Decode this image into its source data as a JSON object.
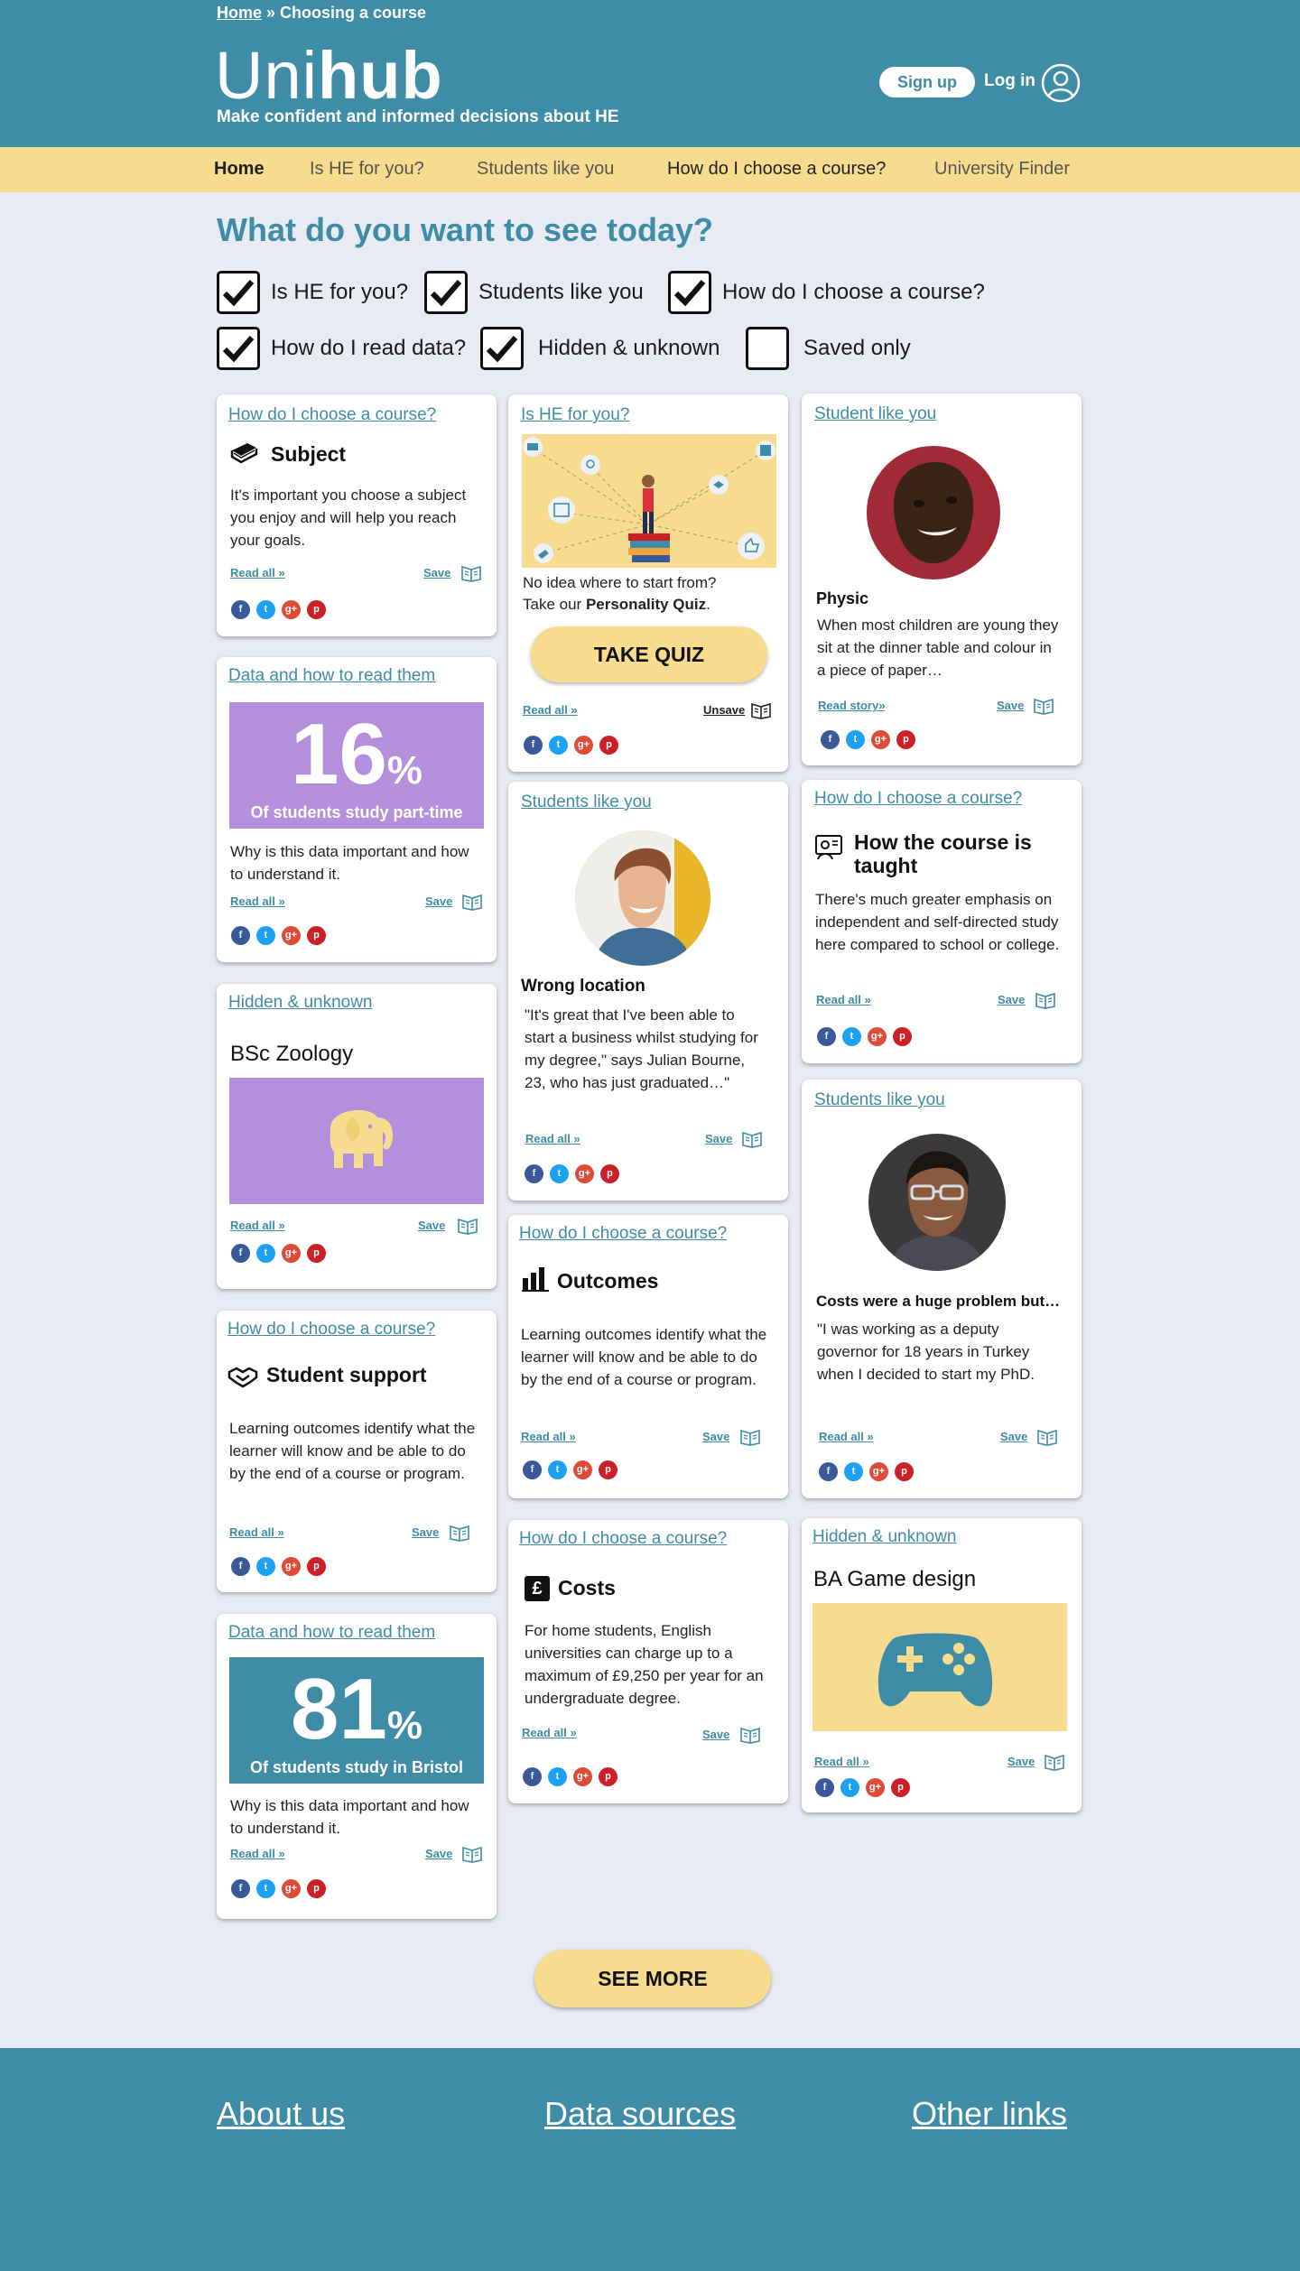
{
  "header": {
    "breadcrumb_home": "Home",
    "breadcrumb_sep": " » ",
    "breadcrumb_current": "Choosing a course",
    "logo_part1": "Uni",
    "logo_part2": "hub",
    "tagline": "Make confident and informed decisions about HE",
    "signup": "Sign up",
    "login": "Log in"
  },
  "nav": {
    "items": [
      "Home",
      "Is HE for you?",
      "Students like you",
      "How do I choose a course?",
      "University Finder"
    ]
  },
  "heading": "What do you want to see today?",
  "filters": [
    {
      "label": "Is HE for you?",
      "checked": true
    },
    {
      "label": "Students like you",
      "checked": true
    },
    {
      "label": "How do I choose a course?",
      "checked": true
    },
    {
      "label": "How do I read data?",
      "checked": true
    },
    {
      "label": "Hidden & unknown",
      "checked": true
    },
    {
      "label": "Saved only",
      "checked": false
    }
  ],
  "common": {
    "read_all": "Read all »",
    "read_story": "Read story»",
    "save": "Save",
    "unsave": "Unsave"
  },
  "cards": {
    "subject": {
      "category": "How do I choose a course?",
      "title": "Subject",
      "body": "It's important you choose a subject you enjoy and will help you reach your goals."
    },
    "data16": {
      "category": "Data and how to read them",
      "number": "16",
      "percent": "%",
      "caption": "Of students study part-time",
      "body": "Why is this data important and how to understand it."
    },
    "zoology": {
      "category": "Hidden & unknown",
      "title": "BSc Zoology"
    },
    "support": {
      "category": "How do I choose a course?",
      "title": "Student support",
      "body": "Learning outcomes identify what the learner will know and be able to do by the end of a course or program."
    },
    "data81": {
      "category": "Data and how to read them",
      "number": "81",
      "percent": "%",
      "caption": "Of students study in Bristol",
      "body": "Why is this data important and how to understand it."
    },
    "quiz": {
      "category": "Is HE for you?",
      "line1": "No idea where to start from?",
      "line2_prefix": "Take our ",
      "line2_bold": "Personality Quiz",
      "line2_suffix": ".",
      "button": "TAKE QUIZ"
    },
    "wrong_location": {
      "category": "Students like you",
      "title": "Wrong location",
      "body": "\"It's great that I've been able to start a business whilst studying for my degree,\" says Julian Bourne, 23, who has just graduated…\""
    },
    "outcomes": {
      "category": "How do I choose a course?",
      "title": "Outcomes",
      "body": "Learning outcomes identify what the learner will know and be able to do by the end of a course or program."
    },
    "costs": {
      "category": "How do I choose a course?",
      "title": "Costs",
      "body": "For home students, English universities can charge up to a maximum of £9,250 per year for an undergraduate degree."
    },
    "physic": {
      "category": "Student like you",
      "title": "Physic",
      "body": "When most children are young they sit at the dinner table and colour in a piece of paper…"
    },
    "taught": {
      "category": "How do I choose a course?",
      "title": "How the course is taught",
      "body": "There's much greater emphasis on independent and self-directed study here compared to school or college."
    },
    "costs_problem": {
      "category": "Students like you",
      "title": "Costs were a huge problem but…",
      "body": "\"I was working as a deputy governor for 18 years in Turkey when I decided to start my PhD."
    },
    "game": {
      "category": "Hidden & unknown",
      "title": "BA Game design"
    }
  },
  "see_more": "SEE MORE",
  "footer": {
    "links": [
      "About us",
      "Data sources",
      "Other links"
    ]
  },
  "colors": {
    "primary": "#3f8ca6",
    "accent": "#f7dc8f",
    "purple": "#b48fdb",
    "background": "#e9ebf3"
  }
}
